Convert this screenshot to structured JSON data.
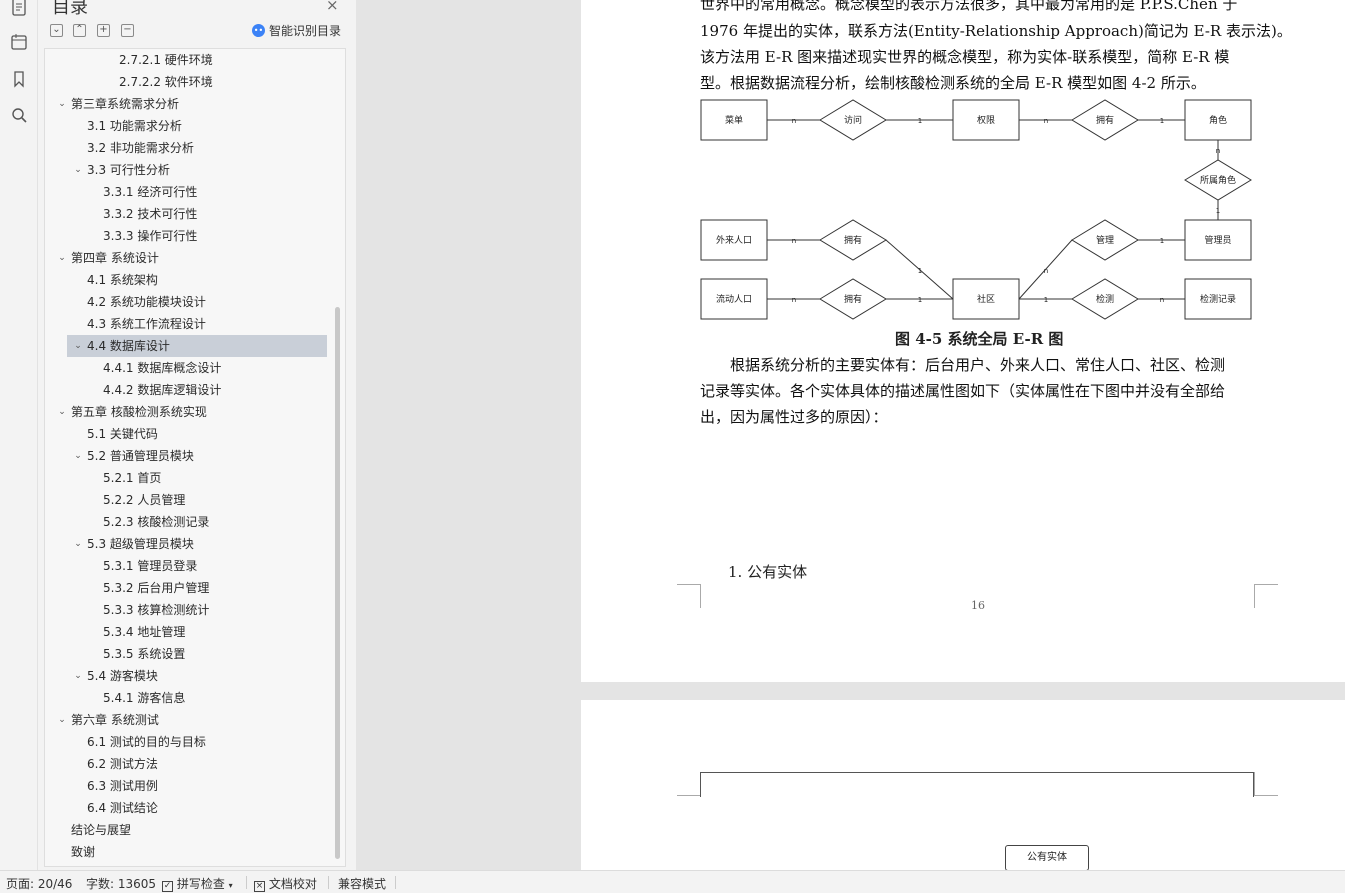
{
  "toc": {
    "title": "目录",
    "close_icon": "×",
    "tools": [
      "⌄",
      "⌃",
      "+",
      "−"
    ],
    "smart_button": "智能识别目录",
    "items": [
      {
        "label": "2.7.2.1  硬件环境",
        "level": 4,
        "chevron": ""
      },
      {
        "label": "2.7.2.2  软件环境",
        "level": 4,
        "chevron": ""
      },
      {
        "label": "第三章系统需求分析",
        "level": 1,
        "chevron": "⌄"
      },
      {
        "label": "3.1  功能需求分析",
        "level": 2,
        "chevron": ""
      },
      {
        "label": "3.2  非功能需求分析",
        "level": 2,
        "chevron": ""
      },
      {
        "label": "3.3  可行性分析",
        "level": 2,
        "chevron": "⌄"
      },
      {
        "label": "3.3.1  经济可行性",
        "level": 3,
        "chevron": ""
      },
      {
        "label": "3.3.2  技术可行性",
        "level": 3,
        "chevron": ""
      },
      {
        "label": "3.3.3  操作可行性",
        "level": 3,
        "chevron": ""
      },
      {
        "label": "第四章  系统设计",
        "level": 1,
        "chevron": "⌄"
      },
      {
        "label": "4.1  系统架构",
        "level": 2,
        "chevron": ""
      },
      {
        "label": "4.2  系统功能模块设计",
        "level": 2,
        "chevron": ""
      },
      {
        "label": "4.3  系统工作流程设计",
        "level": 2,
        "chevron": ""
      },
      {
        "label": "4.4  数据库设计",
        "level": 2,
        "chevron": "⌄",
        "selected": true
      },
      {
        "label": "4.4.1  数据库概念设计",
        "level": 3,
        "chevron": ""
      },
      {
        "label": "4.4.2  数据库逻辑设计",
        "level": 3,
        "chevron": ""
      },
      {
        "label": "第五章  核酸检测系统实现",
        "level": 1,
        "chevron": "⌄"
      },
      {
        "label": "5.1  关键代码",
        "level": 2,
        "chevron": ""
      },
      {
        "label": "5.2  普通管理员模块",
        "level": 2,
        "chevron": "⌄"
      },
      {
        "label": "5.2.1  首页",
        "level": 3,
        "chevron": ""
      },
      {
        "label": "5.2.2 人员管理",
        "level": 3,
        "chevron": ""
      },
      {
        "label": "5.2.3  核酸检测记录",
        "level": 3,
        "chevron": ""
      },
      {
        "label": "5.3  超级管理员模块",
        "level": 2,
        "chevron": "⌄"
      },
      {
        "label": "5.3.1  管理员登录",
        "level": 3,
        "chevron": ""
      },
      {
        "label": "5.3.2 后台用户管理",
        "level": 3,
        "chevron": ""
      },
      {
        "label": "5.3.3  核算检测统计",
        "level": 3,
        "chevron": ""
      },
      {
        "label": "5.3.4  地址管理",
        "level": 3,
        "chevron": ""
      },
      {
        "label": "5.3.5  系统设置",
        "level": 3,
        "chevron": ""
      },
      {
        "label": "5.4  游客模块",
        "level": 2,
        "chevron": "⌄"
      },
      {
        "label": "5.4.1  游客信息",
        "level": 3,
        "chevron": ""
      },
      {
        "label": "第六章  系统测试",
        "level": 1,
        "chevron": "⌄"
      },
      {
        "label": "6.1  测试的目的与目标",
        "level": 2,
        "chevron": ""
      },
      {
        "label": "6.2  测试方法",
        "level": 2,
        "chevron": ""
      },
      {
        "label": "6.3  测试用例",
        "level": 2,
        "chevron": ""
      },
      {
        "label": "6.4  测试结论",
        "level": 2,
        "chevron": ""
      },
      {
        "label": "结论与展望",
        "level": 1,
        "chevron": ""
      },
      {
        "label": "致谢",
        "level": 1,
        "chevron": ""
      }
    ]
  },
  "rail": {
    "icons": [
      "document-icon",
      "outline-icon",
      "bookmark-icon",
      "search-icon"
    ]
  },
  "document": {
    "paragraph_lines": [
      "世界中的常用概念。概念模型的表示方法很多，其中最为常用的是 P.P.S.Chen 于",
      "1976 年提出的实体，联系方法(Entity-Relationship Approach)简记为 E-R 表示法)。",
      "该方法用 E-R 图来描述现实世界的概念模型，称为实体-联系模型，简称 E-R 模",
      "型。根据数据流程分析，绘制核酸检测系统的全局 E-R 模型如图 4-2 所示。"
    ],
    "figure_caption": "图 4-5  系统全局 E-R 图",
    "after_lines": [
      "　　根据系统分析的主要实体有：后台用户、外来人口、常住人口、社区、检测",
      "记录等实体。各个实体具体的描述属性图如下（实体属性在下图中并没有全部给",
      "出，因为属性过多的原因）："
    ],
    "section_label": "1. 公有实体",
    "page_number": "16",
    "page2_entity": "公有实体",
    "er": {
      "entities": {
        "menu": "菜单",
        "perm": "权限",
        "role": "角色",
        "outsider": "外来人口",
        "manager": "管理员",
        "floating": "流动人口",
        "community": "社区",
        "record": "检测记录"
      },
      "relations": {
        "visit": "访问",
        "own1": "拥有",
        "belong": "所属角色",
        "own2": "拥有",
        "manage": "管理",
        "own3": "拥有",
        "detect": "检测"
      },
      "cardinalities": {
        "n": "n",
        "one": "1"
      }
    }
  },
  "status_bar": {
    "page": "页面: 20/46",
    "words": "字数: 13605",
    "spell": "拼写检查",
    "proof": "文档校对",
    "compat": "兼容模式"
  }
}
